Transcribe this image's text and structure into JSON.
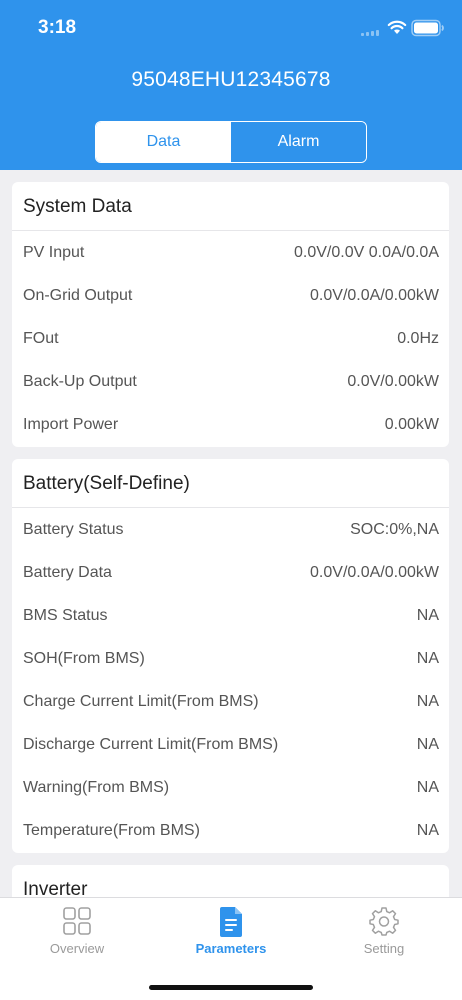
{
  "status_bar": {
    "time": "3:18"
  },
  "header": {
    "title": "95048EHU12345678",
    "tabs": [
      {
        "label": "Data",
        "active": true
      },
      {
        "label": "Alarm",
        "active": false
      }
    ]
  },
  "colors": {
    "accent": "#2f93ec",
    "background": "#efeff2",
    "card": "#ffffff",
    "inactive_tab": "#9a9a9a"
  },
  "system_data": {
    "title": "System Data",
    "rows": [
      {
        "label": "PV Input",
        "value": "0.0V/0.0V 0.0A/0.0A"
      },
      {
        "label": "On-Grid Output",
        "value": "0.0V/0.0A/0.00kW"
      },
      {
        "label": "FOut",
        "value": "0.0Hz"
      },
      {
        "label": "Back-Up Output",
        "value": "0.0V/0.00kW"
      },
      {
        "label": "Import Power",
        "value": "0.00kW"
      }
    ]
  },
  "battery": {
    "title": "Battery(Self-Define)",
    "rows": [
      {
        "label": "Battery Status",
        "value": "SOC:0%,NA"
      },
      {
        "label": "Battery Data",
        "value": "0.0V/0.0A/0.00kW"
      },
      {
        "label": "BMS Status",
        "value": "NA"
      },
      {
        "label": "SOH(From BMS)",
        "value": "NA"
      },
      {
        "label": "Charge Current Limit(From BMS)",
        "value": "NA"
      },
      {
        "label": "Discharge Current Limit(From BMS)",
        "value": "NA"
      },
      {
        "label": "Warning(From BMS)",
        "value": "NA"
      },
      {
        "label": "Temperature(From BMS)",
        "value": "NA"
      }
    ]
  },
  "inverter": {
    "title": "Inverter"
  },
  "tabbar": {
    "items": [
      {
        "label": "Overview",
        "icon": "grid-icon",
        "active": false
      },
      {
        "label": "Parameters",
        "icon": "document-icon",
        "active": true
      },
      {
        "label": "Setting",
        "icon": "gear-icon",
        "active": false
      }
    ]
  }
}
